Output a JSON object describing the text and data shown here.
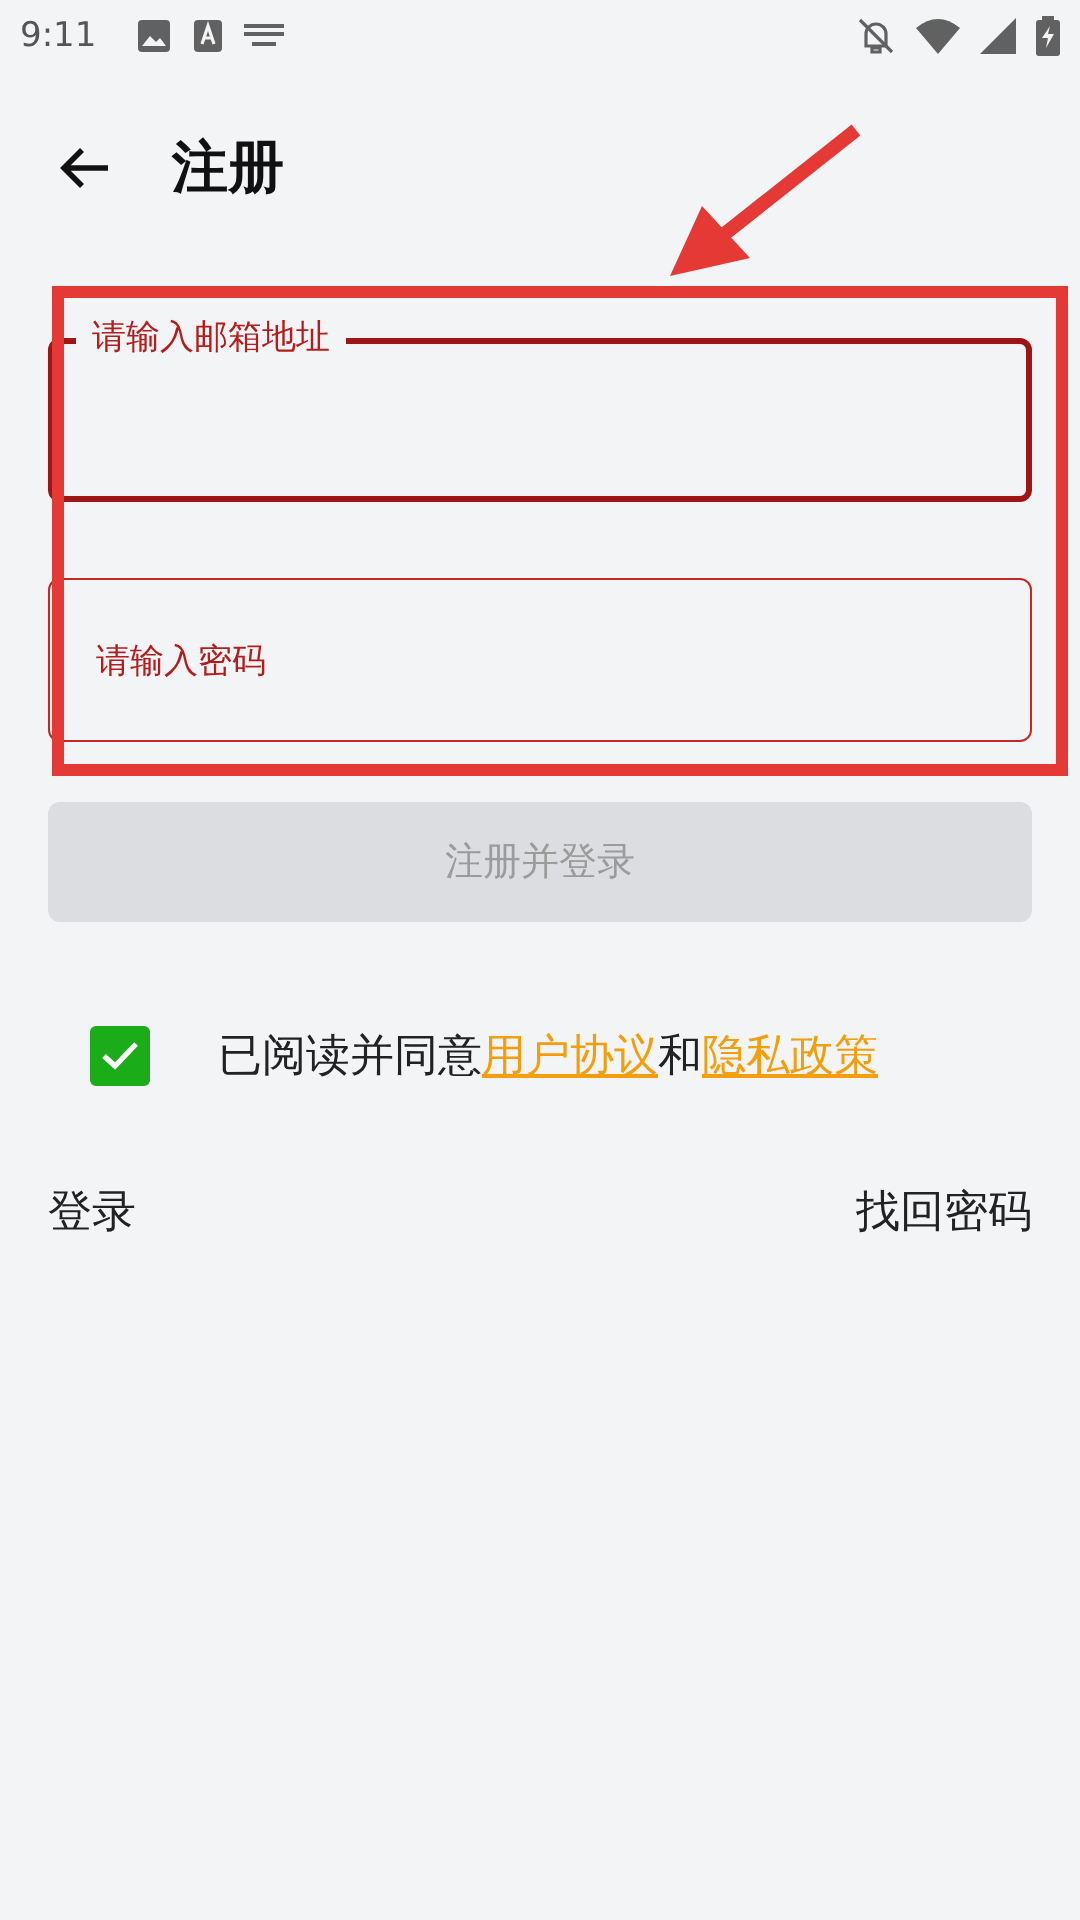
{
  "status_bar": {
    "time": "9:11"
  },
  "header": {
    "title": "注册"
  },
  "fields": [
    {
      "label": "请输入邮箱地址",
      "focused": true
    },
    {
      "label": "请输入密码",
      "focused": false
    }
  ],
  "submit_button": {
    "label": "注册并登录",
    "disabled": true
  },
  "agreement": {
    "checked": true,
    "parts": [
      {
        "kind": "text",
        "text": "已阅读并同意"
      },
      {
        "kind": "link",
        "text": "用户协议"
      },
      {
        "kind": "text",
        "text": "和"
      },
      {
        "kind": "link",
        "text": "隐私政策"
      }
    ]
  },
  "footer_links": [
    "登录",
    "找回密码"
  ],
  "annotations": {
    "highlight_frame": true,
    "arrow": true
  }
}
